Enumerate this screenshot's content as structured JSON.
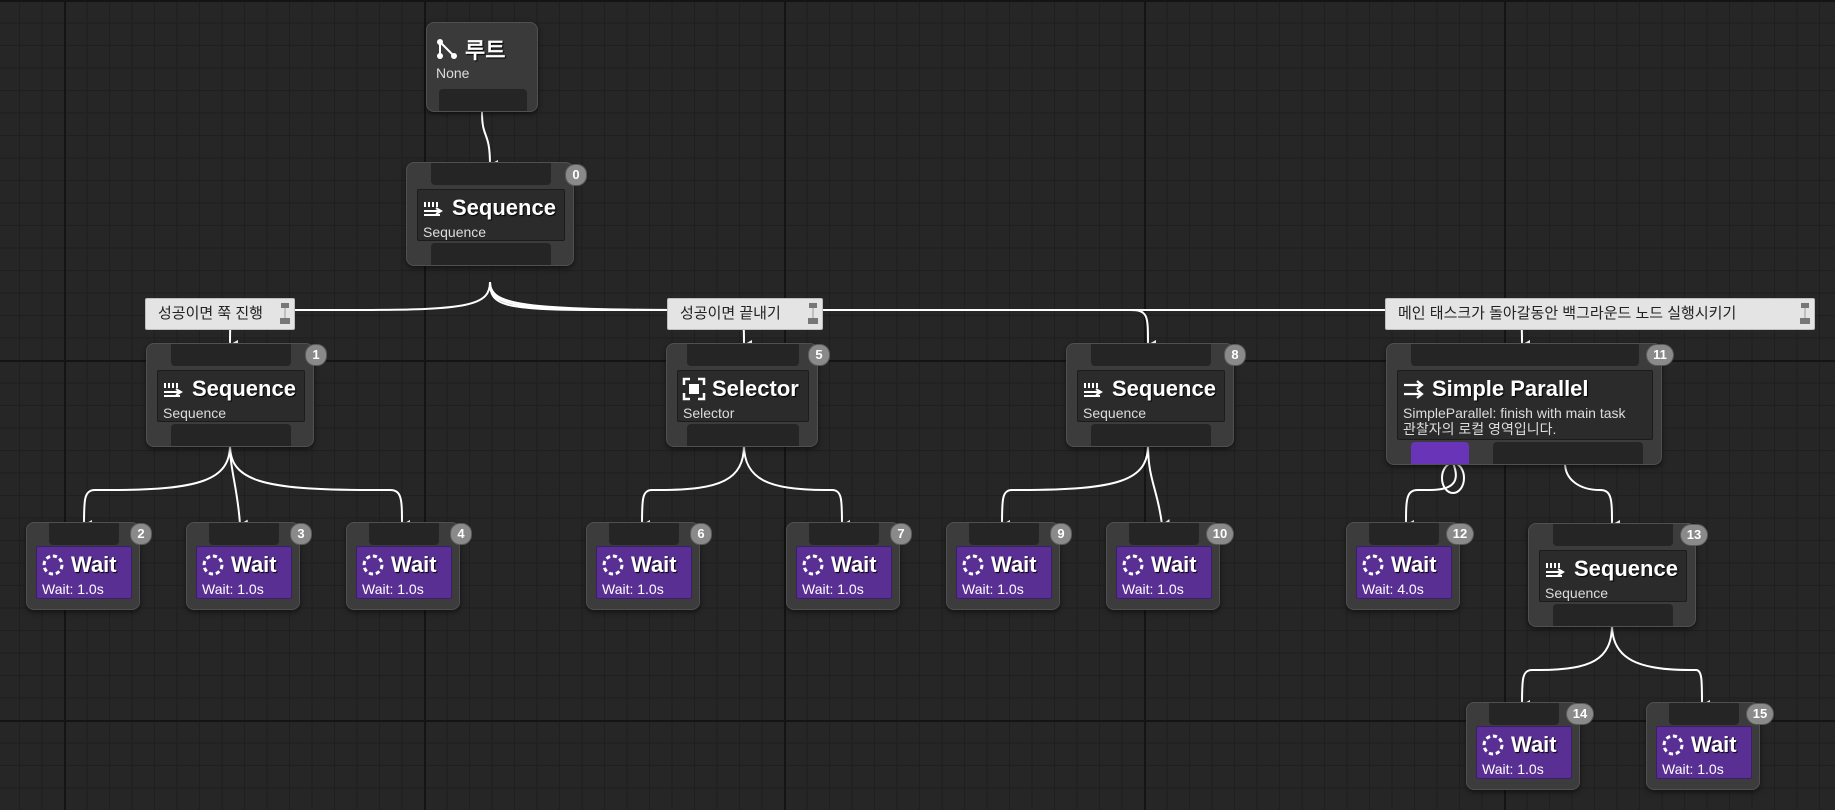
{
  "root": {
    "title": "루트",
    "subtitle": "None"
  },
  "nodes": [
    {
      "id": "0",
      "title": "Sequence",
      "subtitle": "Sequence"
    },
    {
      "id": "1",
      "title": "Sequence",
      "subtitle": "Sequence"
    },
    {
      "id": "2",
      "title": "Wait",
      "subtitle": "Wait: 1.0s"
    },
    {
      "id": "3",
      "title": "Wait",
      "subtitle": "Wait: 1.0s"
    },
    {
      "id": "4",
      "title": "Wait",
      "subtitle": "Wait: 1.0s"
    },
    {
      "id": "5",
      "title": "Selector",
      "subtitle": "Selector"
    },
    {
      "id": "6",
      "title": "Wait",
      "subtitle": "Wait: 1.0s"
    },
    {
      "id": "7",
      "title": "Wait",
      "subtitle": "Wait: 1.0s"
    },
    {
      "id": "8",
      "title": "Sequence",
      "subtitle": "Sequence"
    },
    {
      "id": "9",
      "title": "Wait",
      "subtitle": "Wait: 1.0s"
    },
    {
      "id": "10",
      "title": "Wait",
      "subtitle": "Wait: 1.0s"
    },
    {
      "id": "11",
      "title": "Simple Parallel",
      "subtitle": "SimpleParallel: finish with main task",
      "subtitle2": "관찰자의 로컬 영역입니다."
    },
    {
      "id": "12",
      "title": "Wait",
      "subtitle": "Wait: 4.0s"
    },
    {
      "id": "13",
      "title": "Sequence",
      "subtitle": "Sequence"
    },
    {
      "id": "14",
      "title": "Wait",
      "subtitle": "Wait: 1.0s"
    },
    {
      "id": "15",
      "title": "Wait",
      "subtitle": "Wait: 1.0s"
    }
  ],
  "comments": [
    {
      "text": "성공이면 쭉 진행"
    },
    {
      "text": "성공이면 끝내기"
    },
    {
      "text": "메인 태스크가 돌아갈동안 백그라운드 노드 실행시키기"
    }
  ],
  "icons": {
    "root": "root-branch-icon",
    "sequence": "sequence-arrows-icon",
    "selector": "selector-icon",
    "wait": "wait-spinner-icon",
    "parallel": "parallel-arrows-icon",
    "comment": "comment-note-icon"
  },
  "colors": {
    "background": "#262626",
    "node": "#3c3c3c",
    "task": "#5a2f93",
    "main_task_pin": "#6a34b8",
    "wire": "#ffffff",
    "comment": "#e4e4e4",
    "badge": "#8a8a8a"
  }
}
